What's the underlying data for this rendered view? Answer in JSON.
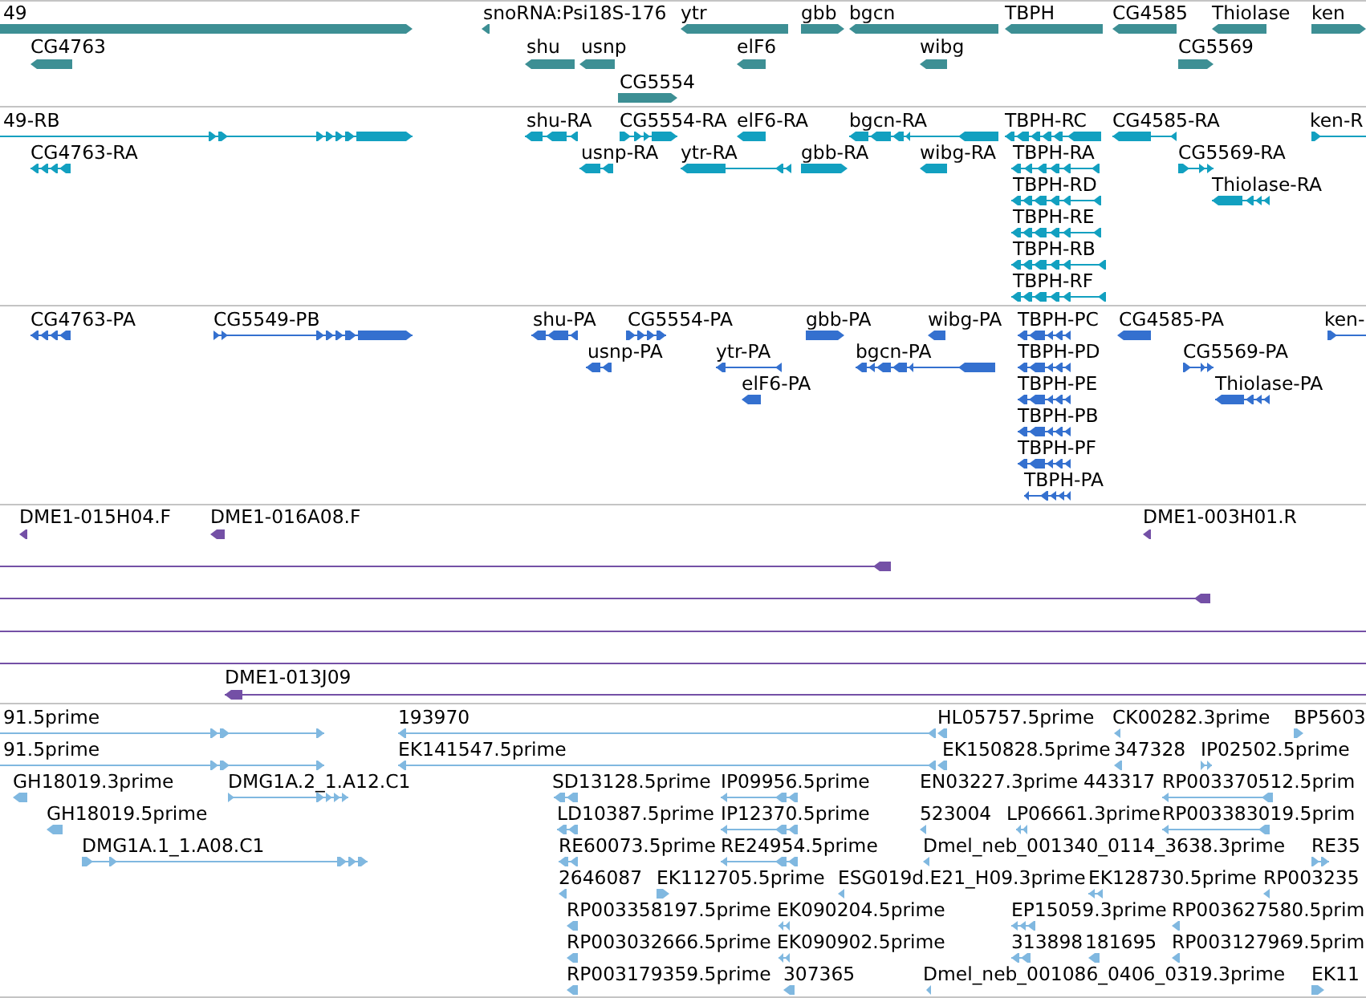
{
  "tracks": [
    {
      "color": "#3d8f94",
      "features": [
        {
          "label": "49",
          "kind": "forward"
        },
        {
          "label": "snoRNA:Psi18S-176",
          "kind": "reverse"
        },
        {
          "label": "ytr",
          "kind": "reverse"
        },
        {
          "label": "gbb",
          "kind": "forward"
        },
        {
          "label": "bgcn",
          "kind": "reverse"
        },
        {
          "label": "TBPH",
          "kind": "reverse"
        },
        {
          "label": "CG4585",
          "kind": "reverse"
        },
        {
          "label": "Thiolase",
          "kind": "reverse"
        },
        {
          "label": "ken",
          "kind": "forward"
        },
        {
          "label": "CG4763",
          "kind": "reverse"
        },
        {
          "label": "shu",
          "kind": "reverse"
        },
        {
          "label": "usnp",
          "kind": "reverse"
        },
        {
          "label": "elF6",
          "kind": "reverse"
        },
        {
          "label": "wibg",
          "kind": "reverse"
        },
        {
          "label": "CG5569",
          "kind": "forward"
        },
        {
          "label": "CG5554",
          "kind": "forward"
        }
      ]
    },
    {
      "color": "#12a0c0",
      "features": [
        {
          "label": "49-RB",
          "kind": "forward"
        },
        {
          "label": "shu-RA",
          "kind": "reverse"
        },
        {
          "label": "CG5554-RA",
          "kind": "forward"
        },
        {
          "label": "elF6-RA",
          "kind": "reverse"
        },
        {
          "label": "bgcn-RA",
          "kind": "reverse"
        },
        {
          "label": "TBPH-RC",
          "kind": "reverse"
        },
        {
          "label": "CG4585-RA",
          "kind": "reverse"
        },
        {
          "label": "ken-R",
          "kind": "forward"
        },
        {
          "label": "CG4763-RA",
          "kind": "reverse"
        },
        {
          "label": "usnp-RA",
          "kind": "reverse"
        },
        {
          "label": "ytr-RA",
          "kind": "reverse"
        },
        {
          "label": "gbb-RA",
          "kind": "forward"
        },
        {
          "label": "wibg-RA",
          "kind": "reverse"
        },
        {
          "label": "TBPH-RA",
          "kind": "reverse"
        },
        {
          "label": "CG5569-RA",
          "kind": "forward"
        },
        {
          "label": "TBPH-RD",
          "kind": "reverse"
        },
        {
          "label": "Thiolase-RA",
          "kind": "reverse"
        },
        {
          "label": "TBPH-RE",
          "kind": "reverse"
        },
        {
          "label": "TBPH-RB",
          "kind": "reverse"
        },
        {
          "label": "TBPH-RF",
          "kind": "reverse"
        }
      ]
    },
    {
      "color": "#3470cf",
      "features": [
        {
          "label": "CG4763-PA",
          "kind": "reverse"
        },
        {
          "label": "CG5549-PB",
          "kind": "forward"
        },
        {
          "label": "shu-PA",
          "kind": "reverse"
        },
        {
          "label": "CG5554-PA",
          "kind": "forward"
        },
        {
          "label": "gbb-PA",
          "kind": "forward"
        },
        {
          "label": "wibg-PA",
          "kind": "reverse"
        },
        {
          "label": "TBPH-PC",
          "kind": "reverse"
        },
        {
          "label": "CG4585-PA",
          "kind": "reverse"
        },
        {
          "label": "ken-",
          "kind": "forward"
        },
        {
          "label": "usnp-PA",
          "kind": "reverse"
        },
        {
          "label": "ytr-PA",
          "kind": "reverse"
        },
        {
          "label": "bgcn-PA",
          "kind": "reverse"
        },
        {
          "label": "TBPH-PD",
          "kind": "reverse"
        },
        {
          "label": "CG5569-PA",
          "kind": "forward"
        },
        {
          "label": "elF6-PA",
          "kind": "reverse"
        },
        {
          "label": "TBPH-PE",
          "kind": "reverse"
        },
        {
          "label": "Thiolase-PA",
          "kind": "reverse"
        },
        {
          "label": "TBPH-PB",
          "kind": "reverse"
        },
        {
          "label": "TBPH-PF",
          "kind": "reverse"
        },
        {
          "label": "TBPH-PA",
          "kind": "reverse"
        }
      ]
    },
    {
      "color": "#7450a6",
      "features": [
        {
          "label": "DME1-015H04.F",
          "kind": "reverse"
        },
        {
          "label": "DME1-016A08.F",
          "kind": "reverse"
        },
        {
          "label": "DME1-003H01.R",
          "kind": "reverse"
        },
        {
          "kind": "reverse"
        },
        {
          "kind": "reverse"
        },
        {
          "kind": "line"
        },
        {
          "kind": "line"
        },
        {
          "label": "DME1-013J09",
          "kind": "reverse"
        }
      ]
    },
    {
      "color": "#80b8e0",
      "features": [
        {
          "label": "91.5prime",
          "kind": "forward"
        },
        {
          "label": "193970",
          "kind": "reverse"
        },
        {
          "label": "HL05757.5prime",
          "kind": "reverse"
        },
        {
          "label": "CK00282.3prime",
          "kind": "reverse"
        },
        {
          "label": "BP5603",
          "kind": "forward"
        },
        {
          "label": "91.5prime",
          "kind": "forward"
        },
        {
          "label": "EK141547.5prime",
          "kind": "reverse"
        },
        {
          "label": "EK150828.5prime",
          "kind": "reverse"
        },
        {
          "label": "347328",
          "kind": "reverse"
        },
        {
          "label": "IP02502.5prime",
          "kind": "forward"
        },
        {
          "label": "GH18019.3prime",
          "kind": "reverse"
        },
        {
          "label": "DMG1A.2_1.A12.C1",
          "kind": "forward"
        },
        {
          "label": "SD13128.5prime",
          "kind": "reverse"
        },
        {
          "label": "IP09956.5prime",
          "kind": "reverse"
        },
        {
          "label": "EN03227.3prime"
        },
        {
          "label": "443317"
        },
        {
          "label": "RP003370512.5prim",
          "kind": "reverse"
        },
        {
          "label": "GH18019.5prime",
          "kind": "reverse"
        },
        {
          "label": "LD10387.5prime",
          "kind": "reverse"
        },
        {
          "label": "IP12370.5prime",
          "kind": "reverse"
        },
        {
          "label": "523004",
          "kind": "reverse"
        },
        {
          "label": "LP06661.3prime",
          "kind": "reverse"
        },
        {
          "label": "RP003383019.5prim",
          "kind": "reverse"
        },
        {
          "label": "DMG1A.1_1.A08.C1",
          "kind": "forward"
        },
        {
          "label": "RE60073.5prime",
          "kind": "reverse"
        },
        {
          "label": "RE24954.5prime",
          "kind": "reverse"
        },
        {
          "label": "Dmel_neb_001340_0114_3638.3prime",
          "kind": "reverse"
        },
        {
          "label": "RE35",
          "kind": "forward"
        },
        {
          "label": "2646087",
          "kind": "reverse"
        },
        {
          "label": "EK112705.5prime",
          "kind": "forward"
        },
        {
          "label": "ESG019d.E21_H09.3prime",
          "kind": "reverse"
        },
        {
          "label": "EK128730.5prime",
          "kind": "reverse"
        },
        {
          "label": "RP003235",
          "kind": "reverse"
        },
        {
          "label": "RP003358197.5prime",
          "kind": "reverse"
        },
        {
          "label": "EK090204.5prime",
          "kind": "reverse"
        },
        {
          "label": "EP15059.3prime",
          "kind": "reverse"
        },
        {
          "label": "RP003627580.5prim",
          "kind": "reverse"
        },
        {
          "label": "RP003032666.5prime",
          "kind": "reverse"
        },
        {
          "label": "EK090902.5prime",
          "kind": "reverse"
        },
        {
          "label": "313898",
          "kind": "reverse"
        },
        {
          "label": "181695",
          "kind": "reverse"
        },
        {
          "label": "RP003127969.5prim",
          "kind": "reverse"
        },
        {
          "label": "RP003179359.5prime",
          "kind": "reverse"
        },
        {
          "label": "307365",
          "kind": "reverse"
        },
        {
          "label": "Dmel_neb_001086_0406_0319.3prime",
          "kind": "reverse"
        },
        {
          "label": "EK11",
          "kind": "forward"
        }
      ]
    }
  ]
}
